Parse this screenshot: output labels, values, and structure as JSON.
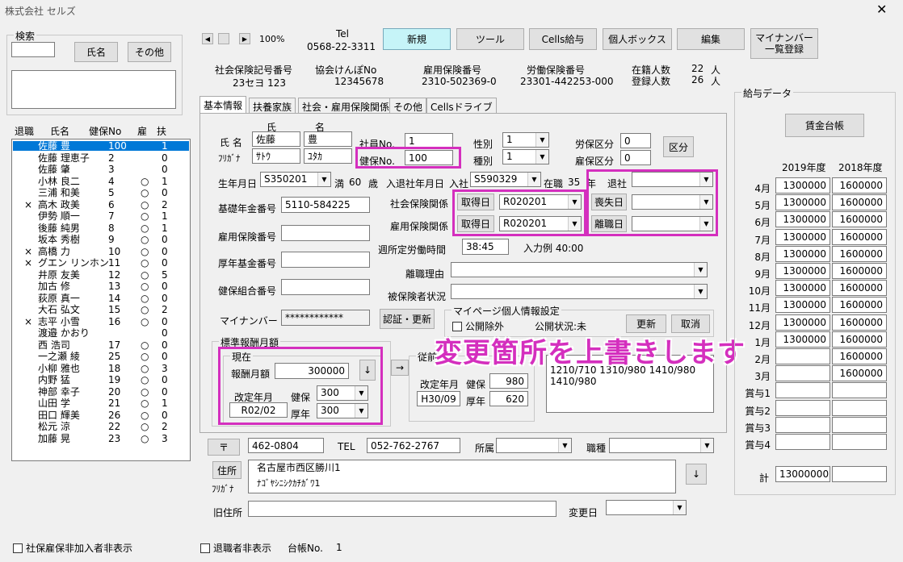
{
  "window_title": "株式会社 セルズ",
  "search": {
    "title": "検索",
    "name_button": "氏名",
    "other_button": "その他",
    "input_value": ""
  },
  "list": {
    "headers": [
      "退職",
      "氏名",
      "健保No",
      "雇",
      "扶"
    ],
    "rows": [
      {
        "retired": "",
        "name": "佐藤 豊",
        "no": "100",
        "koyo": "",
        "fu": "1",
        "selected": true
      },
      {
        "retired": "",
        "name": "佐藤 理恵子",
        "no": "2",
        "koyo": "",
        "fu": "0"
      },
      {
        "retired": "",
        "name": "佐藤 肇",
        "no": "3",
        "koyo": "",
        "fu": "0"
      },
      {
        "retired": "",
        "name": "小林 良二",
        "no": "4",
        "koyo": "○",
        "fu": "1"
      },
      {
        "retired": "",
        "name": "三浦 和美",
        "no": "5",
        "koyo": "○",
        "fu": "0"
      },
      {
        "retired": "×",
        "name": "高木 政美",
        "no": "6",
        "koyo": "○",
        "fu": "2"
      },
      {
        "retired": "",
        "name": "伊勢 順一",
        "no": "7",
        "koyo": "○",
        "fu": "1"
      },
      {
        "retired": "",
        "name": "後藤 純男",
        "no": "8",
        "koyo": "○",
        "fu": "1"
      },
      {
        "retired": "",
        "name": "坂本 秀樹",
        "no": "9",
        "koyo": "○",
        "fu": "0"
      },
      {
        "retired": "×",
        "name": "高橋 力",
        "no": "10",
        "koyo": "○",
        "fu": "0"
      },
      {
        "retired": "×",
        "name": "グエン リンホン",
        "no": "11",
        "koyo": "○",
        "fu": "0"
      },
      {
        "retired": "",
        "name": "井原 友美",
        "no": "12",
        "koyo": "○",
        "fu": "5"
      },
      {
        "retired": "",
        "name": "加古 修",
        "no": "13",
        "koyo": "○",
        "fu": "0"
      },
      {
        "retired": "",
        "name": "荻原 真一",
        "no": "14",
        "koyo": "○",
        "fu": "0"
      },
      {
        "retired": "",
        "name": "大石 弘文",
        "no": "15",
        "koyo": "○",
        "fu": "2"
      },
      {
        "retired": "×",
        "name": "志平 小雪",
        "no": "16",
        "koyo": "○",
        "fu": "0"
      },
      {
        "retired": "",
        "name": "渡邉 かおり",
        "no": "",
        "koyo": "",
        "fu": "0"
      },
      {
        "retired": "",
        "name": "西 浩司",
        "no": "17",
        "koyo": "○",
        "fu": "0"
      },
      {
        "retired": "",
        "name": "一之瀬 綾",
        "no": "25",
        "koyo": "○",
        "fu": "0"
      },
      {
        "retired": "",
        "name": "小柳 雅也",
        "no": "18",
        "koyo": "○",
        "fu": "3"
      },
      {
        "retired": "",
        "name": "内野 猛",
        "no": "19",
        "koyo": "○",
        "fu": "0"
      },
      {
        "retired": "",
        "name": "神部 幸子",
        "no": "20",
        "koyo": "○",
        "fu": "0"
      },
      {
        "retired": "",
        "name": "山田 学",
        "no": "21",
        "koyo": "○",
        "fu": "1"
      },
      {
        "retired": "",
        "name": "田口 輝美",
        "no": "26",
        "koyo": "○",
        "fu": "0"
      },
      {
        "retired": "",
        "name": "松元 涼",
        "no": "22",
        "koyo": "○",
        "fu": "2"
      },
      {
        "retired": "",
        "name": "加藤 晃",
        "no": "23",
        "koyo": "○",
        "fu": "3"
      }
    ]
  },
  "footer": {
    "hide_social": "社保雇保非加入者非表示",
    "hide_retired": "退職者非表示",
    "ledger_label": "台帳No.",
    "ledger_value": "1"
  },
  "toolbar": {
    "zoom": "100%",
    "tel_label": "Tel",
    "tel_value": "0568-22-3311",
    "new": "新規",
    "tools": "ツール",
    "cells_pay": "Cells給与",
    "personal_box": "個人ボックス",
    "edit": "編集",
    "mynumber_line1": "マイナンバー",
    "mynumber_line2": "一覧登録"
  },
  "company_info": {
    "shakai_label": "社会保険記号番号",
    "shakai_value": "23セヨ 123",
    "kyokai_label": "協会けんぽNo",
    "kyokai_value": "12345678",
    "koyo_label": "雇用保険番号",
    "koyo_value": "2310-502369-0",
    "rodo_label": "労働保険番号",
    "rodo_value": "23301-442253-000",
    "zaishoku_label": "在籍人数",
    "zaishoku_value": "22",
    "toroku_label": "登録人数",
    "toroku_value": "26",
    "unit": "人"
  },
  "tabs": [
    "基本情報",
    "扶養家族",
    "社会・雇用保険関係",
    "その他",
    "Cellsドライブ"
  ],
  "basic": {
    "shi": "氏",
    "mei": "名",
    "name_label": "氏 名",
    "surname": "佐藤",
    "given": "豊",
    "kana_label": "ﾌﾘｶﾞﾅ",
    "surname_kana": "ｻﾄｳ",
    "given_kana": "ﾕﾀｶ",
    "emp_no_label": "社員No.",
    "emp_no": "1",
    "kenpo_no_label": "健保No.",
    "kenpo_no": "100",
    "sex_label": "性別",
    "sex": "1",
    "type_label": "種別",
    "type": "1",
    "rohokubun_label": "労保区分",
    "rohokubun": "0",
    "koyokubun_label": "雇保区分",
    "koyokubun": "0",
    "kubun_button": "区分",
    "birth_label": "生年月日",
    "birth": "S350201",
    "age_prefix": "満",
    "age": "60",
    "age_unit": "歳",
    "entry_label": "入退社年月日",
    "entry_prefix": "入社",
    "entry": "S590329",
    "tenure_label": "在職",
    "tenure": "35",
    "tenure_unit": "年",
    "retire_label": "退社",
    "retire": "",
    "pension_label": "基礎年金番号",
    "pension": "5110-584225",
    "shakai_rel": "社会保険関係",
    "koyo_rel": "雇用保険関係",
    "acq_button": "取得日",
    "acq_shakai": "R020201",
    "acq_koyo": "R020201",
    "loss_button": "喪失日",
    "loss": "",
    "leave_button": "離職日",
    "leave": "",
    "koyo_no_label": "雇用保険番号",
    "koyo_no": "",
    "work_hours_label": "週所定労働時間",
    "work_hours": "38:45",
    "input_example": "入力例 40:00",
    "kosei_label": "厚年基金番号",
    "kosei": "",
    "leave_reason_label": "離職理由",
    "leave_reason": "",
    "kenpo_kumiai_label": "健保組合番号",
    "kenpo_kumiai": "",
    "insured_status_label": "被保険者状況",
    "insured_status": "",
    "mynumber_label": "マイナンバー",
    "mynumber": "************",
    "auth_button": "認証・更新",
    "mypage_title": "マイページ個人情報設定",
    "public_exclude": "公開除外",
    "public_status": "公開状況:未",
    "update_button": "更新",
    "cancel_button": "取消"
  },
  "standard": {
    "title": "標準報酬月額",
    "current_title": "現在",
    "monthly_label": "報酬月額",
    "monthly": "300000",
    "revision_label": "改定年月",
    "revision": "R02/02",
    "kenpo_label": "健保",
    "kenpo": "300",
    "kosei_label": "厚年",
    "kosei": "300",
    "previous_title": "従前",
    "prev_revision_label": "改定年月",
    "prev_revision": "H30/09",
    "prev_kenpo_label": "健保",
    "prev_kenpo": "980",
    "prev_kosei_label": "厚年",
    "prev_kosei": "620",
    "history_line1": "1210/710  1310/980 1410/980",
    "history_line2": "1410/980",
    "overlay_text": "変更箇所を上書きします"
  },
  "address": {
    "postal_button": "〒",
    "postal": "462-0804",
    "tel_label": "TEL",
    "tel": "052-762-2767",
    "office_label": "所属",
    "office": "",
    "job_label": "職種",
    "job": "",
    "addr_button": "住所",
    "addr": "名古屋市西区勝川1",
    "kana_label": "ﾌﾘｶﾞﾅ",
    "addr_kana": "ﾅｺﾞﾔｼﾆｼｸｶﾁｶﾞﾜ1",
    "old_addr_label": "旧住所",
    "old_addr": "",
    "change_date_label": "変更日",
    "change_date": ""
  },
  "pay": {
    "title": "給与データ",
    "ledger_button": "賃金台帳",
    "col1": "2019年度",
    "col2": "2018年度",
    "rows": [
      {
        "label": "4月",
        "a": "1300000",
        "b": "1600000"
      },
      {
        "label": "5月",
        "a": "1300000",
        "b": "1600000"
      },
      {
        "label": "6月",
        "a": "1300000",
        "b": "1600000"
      },
      {
        "label": "7月",
        "a": "1300000",
        "b": "1600000"
      },
      {
        "label": "8月",
        "a": "1300000",
        "b": "1600000"
      },
      {
        "label": "9月",
        "a": "1300000",
        "b": "1600000"
      },
      {
        "label": "10月",
        "a": "1300000",
        "b": "1600000"
      },
      {
        "label": "11月",
        "a": "1300000",
        "b": "1600000"
      },
      {
        "label": "12月",
        "a": "1300000",
        "b": "1600000"
      },
      {
        "label": "1月",
        "a": "1300000",
        "b": "1600000"
      },
      {
        "label": "2月",
        "a": "",
        "b": "1600000"
      },
      {
        "label": "3月",
        "a": "",
        "b": "1600000"
      },
      {
        "label": "賞与1",
        "a": "",
        "b": ""
      },
      {
        "label": "賞与2",
        "a": "",
        "b": ""
      },
      {
        "label": "賞与3",
        "a": "",
        "b": ""
      },
      {
        "label": "賞与4",
        "a": "",
        "b": ""
      }
    ],
    "total_label": "計",
    "total_a": "13000000",
    "total_b": ""
  },
  "colors": {
    "highlight": "#d42fbe",
    "selection": "#0078d7",
    "new_button": "#c6f4f8"
  }
}
